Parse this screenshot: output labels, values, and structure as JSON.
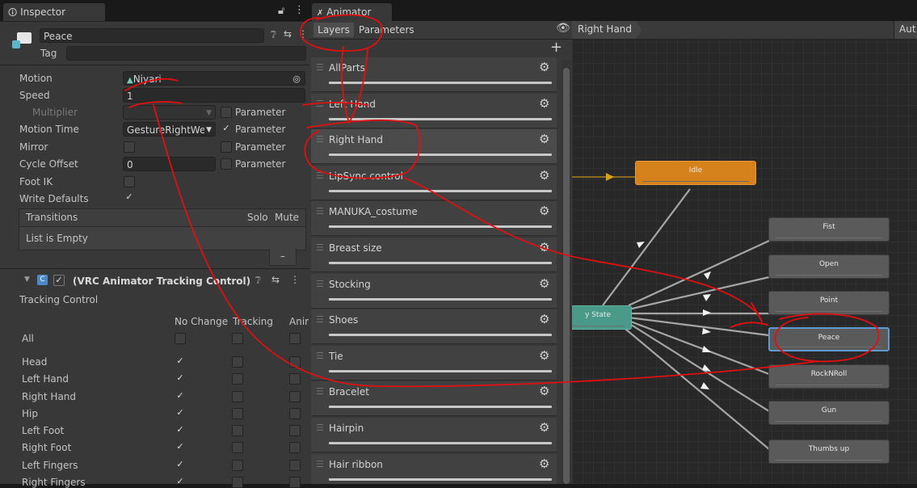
{
  "inspector": {
    "tab_title": "Inspector",
    "object_name": "Peace",
    "tag_label": "Tag",
    "tag_value": "",
    "fields": {
      "motion_label": "Motion",
      "motion_value": "Niyari",
      "speed_label": "Speed",
      "speed_value": "1",
      "multiplier_label": "Multiplier",
      "multiplier_param_label": "Parameter",
      "motion_time_label": "Motion Time",
      "motion_time_value": "GestureRightWe",
      "motion_time_param_label": "Parameter",
      "mirror_label": "Mirror",
      "mirror_param_label": "Parameter",
      "cycle_offset_label": "Cycle Offset",
      "cycle_offset_value": "0",
      "cycle_offset_param_label": "Parameter",
      "foot_ik_label": "Foot IK",
      "write_defaults_label": "Write Defaults"
    },
    "transitions": {
      "header": "Transitions",
      "solo": "Solo",
      "mute": "Mute",
      "empty_text": "List is Empty",
      "remove_button": "–"
    },
    "component": {
      "title": "(VRC Animator Tracking Control)",
      "section": "Tracking Control",
      "col_no_change": "No Change",
      "col_tracking": "Tracking",
      "col_anim": "Anir",
      "rows": [
        "All",
        "Head",
        "Left Hand",
        "Right Hand",
        "Hip",
        "Left Foot",
        "Right Foot",
        "Left Fingers",
        "Right Fingers"
      ]
    }
  },
  "animator": {
    "tab_title": "Animator",
    "tab_layers": "Layers",
    "tab_parameters": "Parameters",
    "breadcrumb": "Right Hand",
    "auto_live": "Aut",
    "add_button": "+",
    "layers": [
      "AllParts",
      "Left Hand",
      "Right Hand",
      "LipSync control",
      "MANUKA_costume",
      "Breast size",
      "Stocking",
      "Shoes",
      "Tie",
      "Bracelet",
      "Hairpin",
      "Hair ribbon"
    ],
    "selected_layer": "Right Hand",
    "states": {
      "idle": "Idle",
      "any_state": "y State",
      "fist": "Fist",
      "open": "Open",
      "point": "Point",
      "peace": "Peace",
      "rocknroll": "RockNRoll",
      "gun": "Gun",
      "thumbs_up": "Thumbs up"
    }
  },
  "colors": {
    "idle_state": "#d5811c",
    "any_state": "#4a9a8a",
    "annotation": "#e01010"
  }
}
